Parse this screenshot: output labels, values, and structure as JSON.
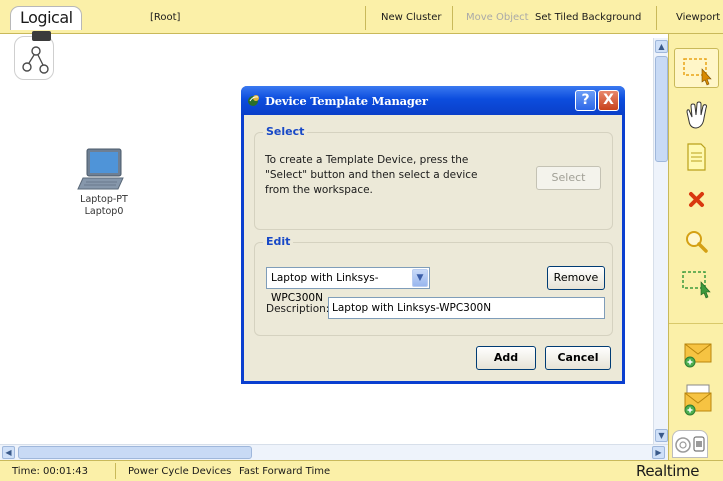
{
  "topbar": {
    "logical": "Logical",
    "root": "[Root]",
    "new_cluster": "New Cluster",
    "move_object": "Move Object",
    "set_tiled_background": "Set Tiled Background",
    "viewport": "Viewport"
  },
  "canvas": {
    "device": {
      "type": "Laptop-PT",
      "name": "Laptop0"
    }
  },
  "dialog": {
    "title": "Device Template Manager",
    "help": "?",
    "close": "X",
    "select_group": {
      "legend": "Select",
      "description": "To create a Template Device, press the \"Select\" button and then select a device from the workspace.",
      "select_button": "Select"
    },
    "edit_group": {
      "legend": "Edit",
      "template_value": "Laptop with Linksys-WPC300N",
      "remove_button": "Remove",
      "description_label": "Description:",
      "description_value": "Laptop with Linksys-WPC300N"
    },
    "add_button": "Add",
    "cancel_button": "Cancel"
  },
  "statusbar": {
    "time": "Time: 00:01:43",
    "power_cycle": "Power Cycle Devices",
    "fast_forward": "Fast Forward Time",
    "realtime": "Realtime"
  },
  "right_toolbar": {
    "tools": [
      "select-tool",
      "move-hand-tool",
      "place-note-tool",
      "delete-tool",
      "inspect-tool",
      "resize-shape-tool",
      "add-simple-pdu-tool",
      "add-complex-pdu-tool"
    ]
  },
  "colors": {
    "toolbar_bg": "#fbf0a8",
    "dialog_title": "#0c4dde",
    "group_legend": "#1748c7",
    "dialog_bg": "#ece9d8"
  }
}
